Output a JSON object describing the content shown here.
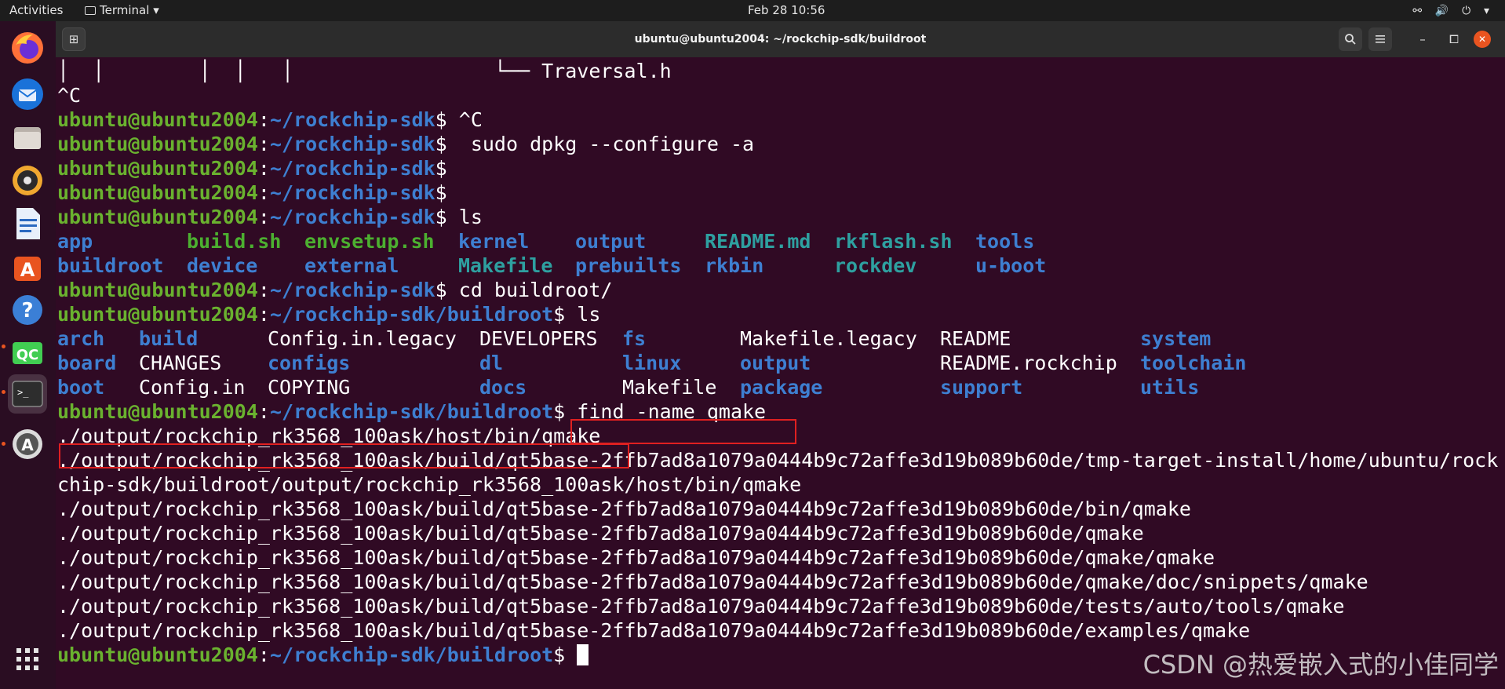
{
  "topbar": {
    "activities": "Activities",
    "app_menu": "Terminal",
    "clock": "Feb 28  10:56",
    "tray": {
      "network": "⚯",
      "volume": "🔊",
      "power": "⏻",
      "menu": "▾"
    }
  },
  "dock": {
    "items": [
      "firefox",
      "thunderbird",
      "files",
      "rhythmbox",
      "libreoffice-writer",
      "ubuntu-software",
      "help",
      "qt-creator",
      "terminal",
      "software-updater",
      "show-apps"
    ],
    "qt_label": "QC"
  },
  "window": {
    "title": "ubuntu@ubuntu2004: ~/rockchip-sdk/buildroot",
    "buttons": {
      "minimize": "–",
      "maximize": "⧠",
      "close": "✕"
    }
  },
  "colors": {
    "background": "#300a24",
    "user": "#6ab22f",
    "path": "#3e7fd1",
    "highlight": "#e02020"
  },
  "terminal": {
    "tree_bars": "│  │        │  │   │                 ",
    "tree_leaf": "└── Traversal.h",
    "ctrl_c": "^C",
    "user_host": "ubuntu@ubuntu2004",
    "colon": ":",
    "path_sdk": "~/rockchip-sdk",
    "path_buildroot": "~/rockchip-sdk/buildroot",
    "dollar": "$",
    "cmd1": " ^C",
    "cmd2": "  sudo dpkg --configure -a",
    "cmd_ls": " ls",
    "cmd_cd": " cd buildroot/",
    "cmd_find": " find -name qmake",
    "sdk_ls": {
      "row1": [
        "app",
        "build.sh",
        "envsetup.sh",
        "kernel",
        "output",
        "README.md",
        "rkflash.sh",
        "tools"
      ],
      "row2": [
        "buildroot",
        "device",
        "external",
        "Makefile",
        "prebuilts",
        "rkbin",
        "rockdev",
        "u-boot"
      ]
    },
    "buildroot_ls": {
      "row1": [
        "arch",
        "build",
        "Config.in.legacy",
        "DEVELOPERS",
        "fs",
        "Makefile.legacy",
        "README",
        "system"
      ],
      "row2": [
        "board",
        "CHANGES",
        "configs",
        "dl",
        "linux",
        "output",
        "README.rockchip",
        "toolchain"
      ],
      "row3": [
        "boot",
        "Config.in",
        "COPYING",
        "docs",
        "Makefile",
        "package",
        "support",
        "utils"
      ]
    },
    "results": [
      "./output/rockchip_rk3568_100ask/host/bin/qmake",
      "./output/rockchip_rk3568_100ask/build/qt5base-2ffb7ad8a1079a0444b9c72affe3d19b089b60de/tmp-target-install/home/ubuntu/rock",
      "chip-sdk/buildroot/output/rockchip_rk3568_100ask/host/bin/qmake",
      "./output/rockchip_rk3568_100ask/build/qt5base-2ffb7ad8a1079a0444b9c72affe3d19b089b60de/bin/qmake",
      "./output/rockchip_rk3568_100ask/build/qt5base-2ffb7ad8a1079a0444b9c72affe3d19b089b60de/qmake",
      "./output/rockchip_rk3568_100ask/build/qt5base-2ffb7ad8a1079a0444b9c72affe3d19b089b60de/qmake/qmake",
      "./output/rockchip_rk3568_100ask/build/qt5base-2ffb7ad8a1079a0444b9c72affe3d19b089b60de/qmake/doc/snippets/qmake",
      "./output/rockchip_rk3568_100ask/build/qt5base-2ffb7ad8a1079a0444b9c72affe3d19b089b60de/tests/auto/tools/qmake",
      "./output/rockchip_rk3568_100ask/build/qt5base-2ffb7ad8a1079a0444b9c72affe3d19b089b60de/examples/qmake"
    ]
  },
  "watermark": "CSDN @热爱嵌入式的小佳同学"
}
